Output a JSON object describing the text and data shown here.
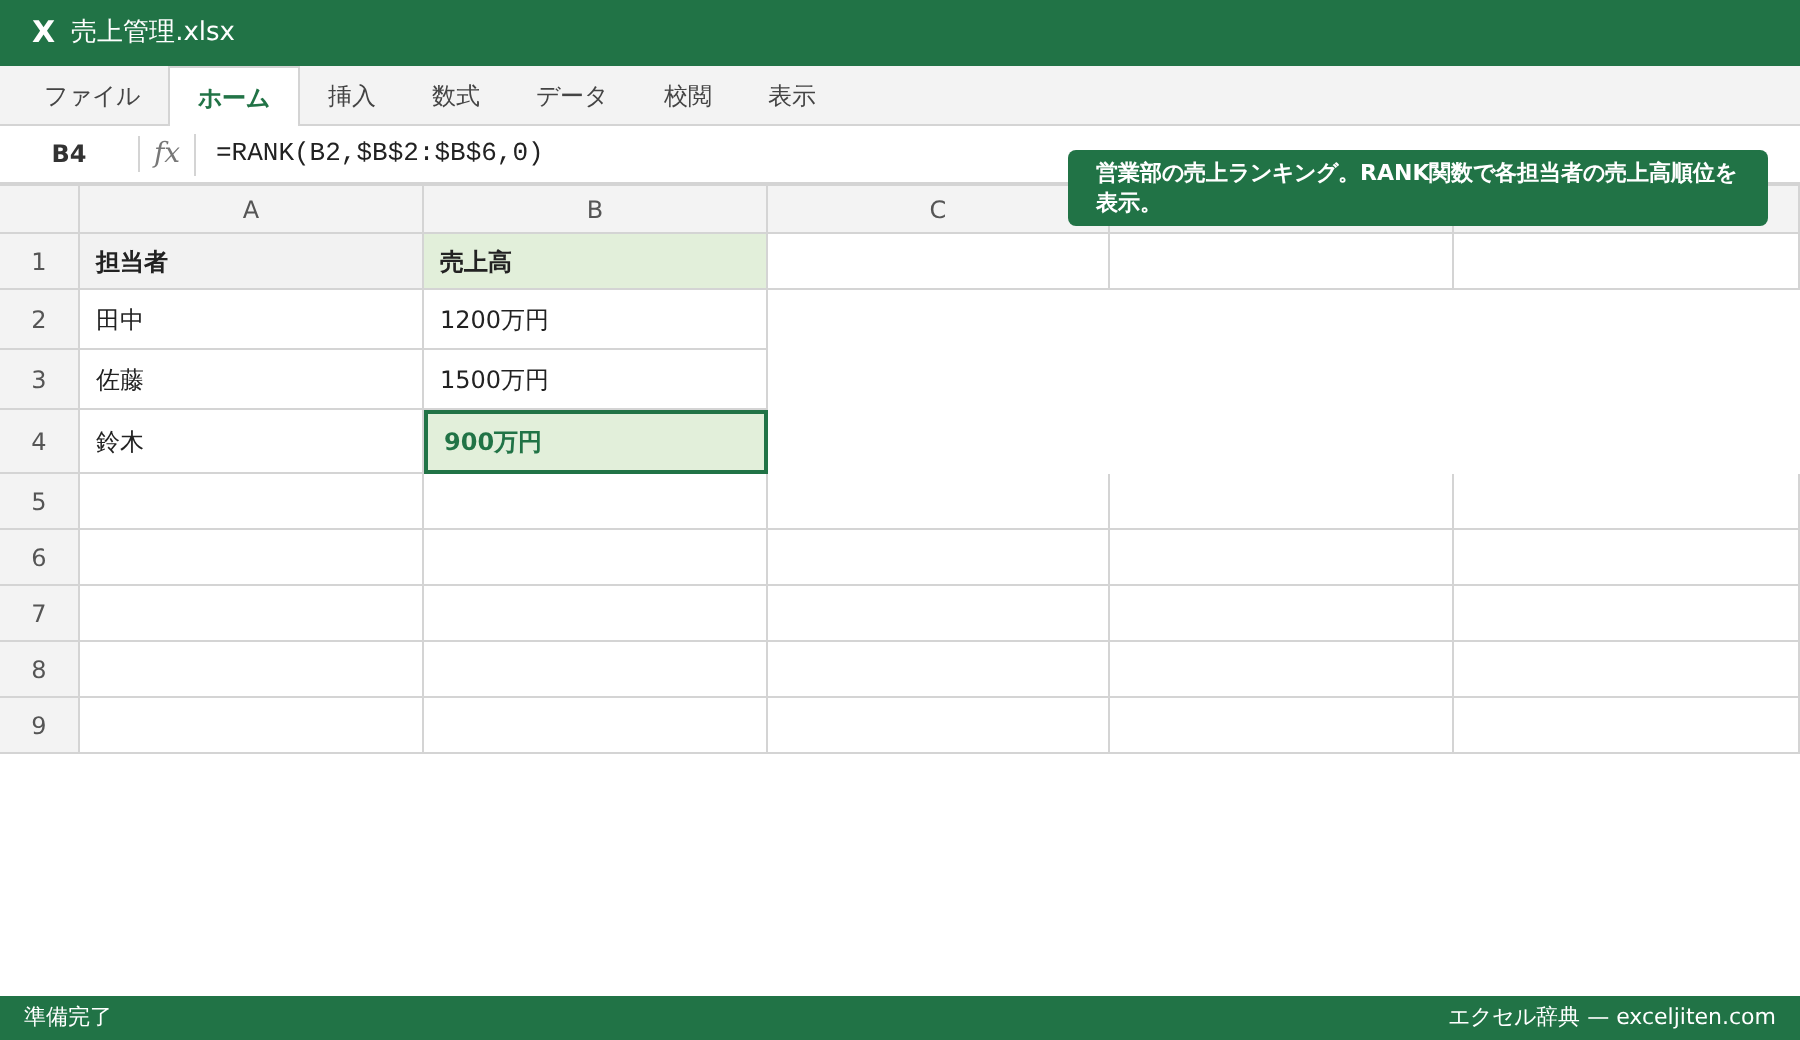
{
  "window": {
    "app_icon": "X",
    "title": "売上管理.xlsx"
  },
  "tabs": [
    {
      "label": "ファイル",
      "selected": false
    },
    {
      "label": "ホーム",
      "selected": true
    },
    {
      "label": "挿入",
      "selected": false
    },
    {
      "label": "数式",
      "selected": false
    },
    {
      "label": "データ",
      "selected": false
    },
    {
      "label": "校閲",
      "selected": false
    },
    {
      "label": "表示",
      "selected": false
    }
  ],
  "formula_bar": {
    "name_box": "B4",
    "fx": "fx",
    "formula": "=RANK(B2,$B$2:$B$6,0)"
  },
  "tooltip": "営業部の売上ランキング。RANK関数で各担当者の売上高順位を表示。",
  "sheet": {
    "columns": [
      "A",
      "B",
      "C"
    ],
    "rows": [
      {
        "number": "1",
        "kind": "header",
        "cells": [
          {
            "text": "担当者",
            "color": "#f2f2f2",
            "selected": false
          },
          {
            "text": "売上高",
            "color": "#e2efda",
            "selected": false
          }
        ]
      },
      {
        "number": "2",
        "kind": "data",
        "cells": [
          {
            "text": "田中",
            "selected": false
          },
          {
            "text": "1200万円",
            "selected": false
          }
        ]
      },
      {
        "number": "3",
        "kind": "data",
        "cells": [
          {
            "text": "佐藤",
            "selected": false
          },
          {
            "text": "1500万円",
            "selected": false
          }
        ]
      },
      {
        "number": "4",
        "kind": "data",
        "cells": [
          {
            "text": "鈴木",
            "selected": false
          },
          {
            "text": "900万円",
            "color": "#e2efda",
            "selected": true
          }
        ]
      },
      {
        "number": "5",
        "kind": "empty"
      },
      {
        "number": "6",
        "kind": "empty"
      },
      {
        "number": "7",
        "kind": "empty"
      },
      {
        "number": "8",
        "kind": "empty"
      },
      {
        "number": "9",
        "kind": "empty"
      }
    ]
  },
  "status_bar": {
    "left": "準備完了",
    "right": "エクセル辞典 — exceljiten.com"
  }
}
